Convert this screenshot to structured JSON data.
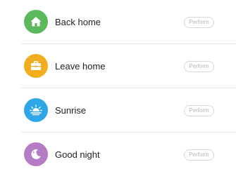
{
  "scenes": [
    {
      "label": "Back home",
      "action": "Perform",
      "icon": "home-icon",
      "color": "#5cb85c"
    },
    {
      "label": "Leave home",
      "action": "Perform",
      "icon": "briefcase-icon",
      "color": "#f0ad1e"
    },
    {
      "label": "Sunrise",
      "action": "Perform",
      "icon": "sunrise-icon",
      "color": "#2fa6e6"
    },
    {
      "label": "Good night",
      "action": "Perform",
      "icon": "moon-icon",
      "color": "#b57bc4"
    }
  ]
}
